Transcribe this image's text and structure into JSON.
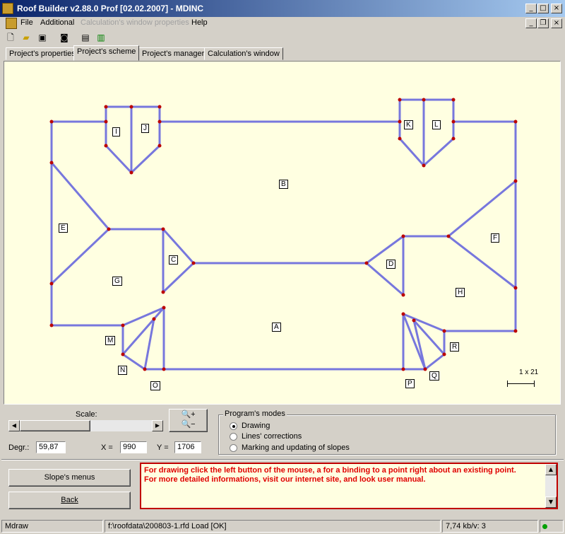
{
  "window": {
    "title": "Roof Builder v2.88.0 Prof  [02.02.2007] - MDINC",
    "minimize": "_",
    "maximize": "□",
    "close": "×",
    "restore": "❐"
  },
  "menu": {
    "items": [
      "File",
      "Additional",
      "Calculation's window properties",
      "Help"
    ]
  },
  "toolbar": {
    "icons": [
      "new-document-icon",
      "open-folder-icon",
      "save-disk-icon",
      "preview-icon",
      "print-icon",
      "chart-icon"
    ]
  },
  "tabs": [
    "Project's properties",
    "Project's scheme",
    "Project's manager",
    "Calculation's window"
  ],
  "active_tab": "Project's scheme",
  "scheme": {
    "line_color": "#7777dd",
    "point_color": "#bb0000",
    "slope_labels": [
      "A",
      "B",
      "C",
      "D",
      "E",
      "F",
      "G",
      "H",
      "I",
      "J",
      "K",
      "L",
      "M",
      "N",
      "O",
      "P",
      "Q",
      "R"
    ],
    "scale_text": "1 x 21"
  },
  "controls": {
    "scale_label": "Scale:",
    "zoom_in": "🔍+",
    "zoom_out": "🔍−",
    "degr_label": "Degr.:",
    "degr_value": "59,87",
    "x_label": "X =",
    "x_value": "990",
    "y_label": "Y =",
    "y_value": "1706",
    "modes_title": "Program's modes",
    "modes": [
      "Drawing",
      "Lines' corrections",
      "Marking and updating of slopes"
    ],
    "selected_mode": "Drawing",
    "slopes_menu_button": "Slope's menus",
    "back_button": "Back"
  },
  "message": {
    "line1": "For drawing click the left button of the mouse, a for a binding to a point right about an existing point.",
    "line2": "For more detailed informations, visit our internet site, and look user manual."
  },
  "status": {
    "mode": "Mdraw",
    "file": "f:\\roofdata\\200803-1.rfd Load [OK]",
    "speed": "7,74 kb/v: 3"
  },
  "colors": {
    "title_start": "#0a246a",
    "title_end": "#a6caf0",
    "canvas_bg": "#ffffe1",
    "message_text": "#e00000",
    "message_border": "#c00000",
    "status_led": "#00a000"
  }
}
